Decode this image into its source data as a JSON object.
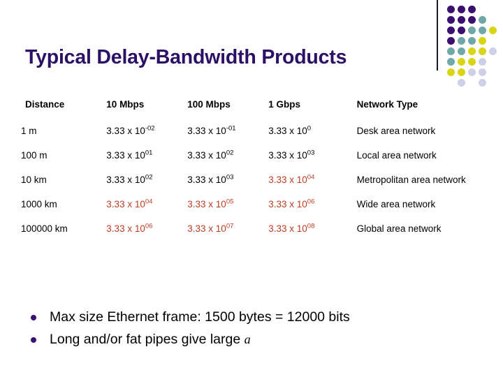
{
  "slide": {
    "title": "Typical Delay-Bandwidth Products"
  },
  "colors": {
    "title": "#2c1065",
    "highlight_red": "#bd3c20",
    "bullet": "#3a1070",
    "dot_dark_purple": "#3b1070",
    "dot_teal": "#6fa8a8",
    "dot_yellow": "#d9d414",
    "dot_lavender": "#cdd1e8",
    "divider": "#1a1a2e"
  },
  "table": {
    "headers": [
      "Distance",
      "10 Mbps",
      "100 Mbps",
      "1 Gbps",
      "Network Type"
    ],
    "rows": [
      {
        "distance": "1 m",
        "mbps10": {
          "mantissa": "3.33 x 10",
          "exponent": "-02",
          "red": false
        },
        "mbps100": {
          "mantissa": "3.33 x 10",
          "exponent": "-01",
          "red": false,
          "wrap_exponent": true
        },
        "gbps1": {
          "mantissa": "3.33 x 10",
          "exponent": "0",
          "red": false
        },
        "network_type": "Desk area network"
      },
      {
        "distance": "100 m",
        "mbps10": {
          "mantissa": "3.33 x 10",
          "exponent": "01",
          "red": false
        },
        "mbps100": {
          "mantissa": "3.33 x 10",
          "exponent": "02",
          "red": false
        },
        "gbps1": {
          "mantissa": "3.33 x 10",
          "exponent": "03",
          "red": false
        },
        "network_type": "Local area network"
      },
      {
        "distance": "10 km",
        "mbps10": {
          "mantissa": "3.33 x 10",
          "exponent": "02",
          "red": false
        },
        "mbps100": {
          "mantissa": "3.33 x 10",
          "exponent": "03",
          "red": false
        },
        "gbps1": {
          "mantissa": "3.33 x 10",
          "exponent": "04",
          "red": true
        },
        "network_type": "Metropolitan area network"
      },
      {
        "distance": "1000 km",
        "mbps10": {
          "mantissa": "3.33 x 10",
          "exponent": "04",
          "red": true
        },
        "mbps100": {
          "mantissa": "3.33 x 10",
          "exponent": "05",
          "red": true
        },
        "gbps1": {
          "mantissa": "3.33 x 10",
          "exponent": "06",
          "red": true
        },
        "network_type": "Wide area network"
      },
      {
        "distance": "100000 km",
        "mbps10": {
          "mantissa": "3.33 x 10",
          "exponent": "06",
          "red": true
        },
        "mbps100": {
          "mantissa": "3.33 x 10",
          "exponent": "07",
          "red": true
        },
        "gbps1": {
          "mantissa": "3.33 x 10",
          "exponent": "08",
          "red": true
        },
        "network_type": "Global area network"
      }
    ]
  },
  "bullets": [
    {
      "text": "Max size Ethernet frame:  1500 bytes = 12000 bits",
      "math_suffix": ""
    },
    {
      "text": "Long and/or fat pipes give large ",
      "math_suffix": "a"
    }
  ],
  "decoration": {
    "dot_grid": {
      "rows": 8,
      "cols": 5,
      "spacing": 15,
      "dots": [
        {
          "r": 0,
          "c": 0,
          "color": "#3b1070"
        },
        {
          "r": 0,
          "c": 1,
          "color": "#3b1070"
        },
        {
          "r": 0,
          "c": 2,
          "color": "#3b1070"
        },
        {
          "r": 1,
          "c": 0,
          "color": "#3b1070"
        },
        {
          "r": 1,
          "c": 1,
          "color": "#3b1070"
        },
        {
          "r": 1,
          "c": 2,
          "color": "#3b1070"
        },
        {
          "r": 1,
          "c": 3,
          "color": "#6fa8a8"
        },
        {
          "r": 2,
          "c": 0,
          "color": "#3b1070"
        },
        {
          "r": 2,
          "c": 1,
          "color": "#3b1070"
        },
        {
          "r": 2,
          "c": 2,
          "color": "#6fa8a8"
        },
        {
          "r": 2,
          "c": 3,
          "color": "#6fa8a8"
        },
        {
          "r": 2,
          "c": 4,
          "color": "#d9d414"
        },
        {
          "r": 3,
          "c": 0,
          "color": "#3b1070"
        },
        {
          "r": 3,
          "c": 1,
          "color": "#6fa8a8"
        },
        {
          "r": 3,
          "c": 2,
          "color": "#6fa8a8"
        },
        {
          "r": 3,
          "c": 3,
          "color": "#d9d414"
        },
        {
          "r": 4,
          "c": 0,
          "color": "#6fa8a8"
        },
        {
          "r": 4,
          "c": 1,
          "color": "#6fa8a8"
        },
        {
          "r": 4,
          "c": 2,
          "color": "#d9d414"
        },
        {
          "r": 4,
          "c": 3,
          "color": "#d9d414"
        },
        {
          "r": 4,
          "c": 4,
          "color": "#cdd1e8"
        },
        {
          "r": 5,
          "c": 0,
          "color": "#6fa8a8"
        },
        {
          "r": 5,
          "c": 1,
          "color": "#d9d414"
        },
        {
          "r": 5,
          "c": 2,
          "color": "#d9d414"
        },
        {
          "r": 5,
          "c": 3,
          "color": "#cdd1e8"
        },
        {
          "r": 6,
          "c": 0,
          "color": "#d9d414"
        },
        {
          "r": 6,
          "c": 1,
          "color": "#d9d414"
        },
        {
          "r": 6,
          "c": 2,
          "color": "#cdd1e8"
        },
        {
          "r": 6,
          "c": 3,
          "color": "#cdd1e8"
        },
        {
          "r": 7,
          "c": 1,
          "color": "#cdd1e8"
        },
        {
          "r": 7,
          "c": 3,
          "color": "#cdd1e8"
        }
      ]
    }
  }
}
